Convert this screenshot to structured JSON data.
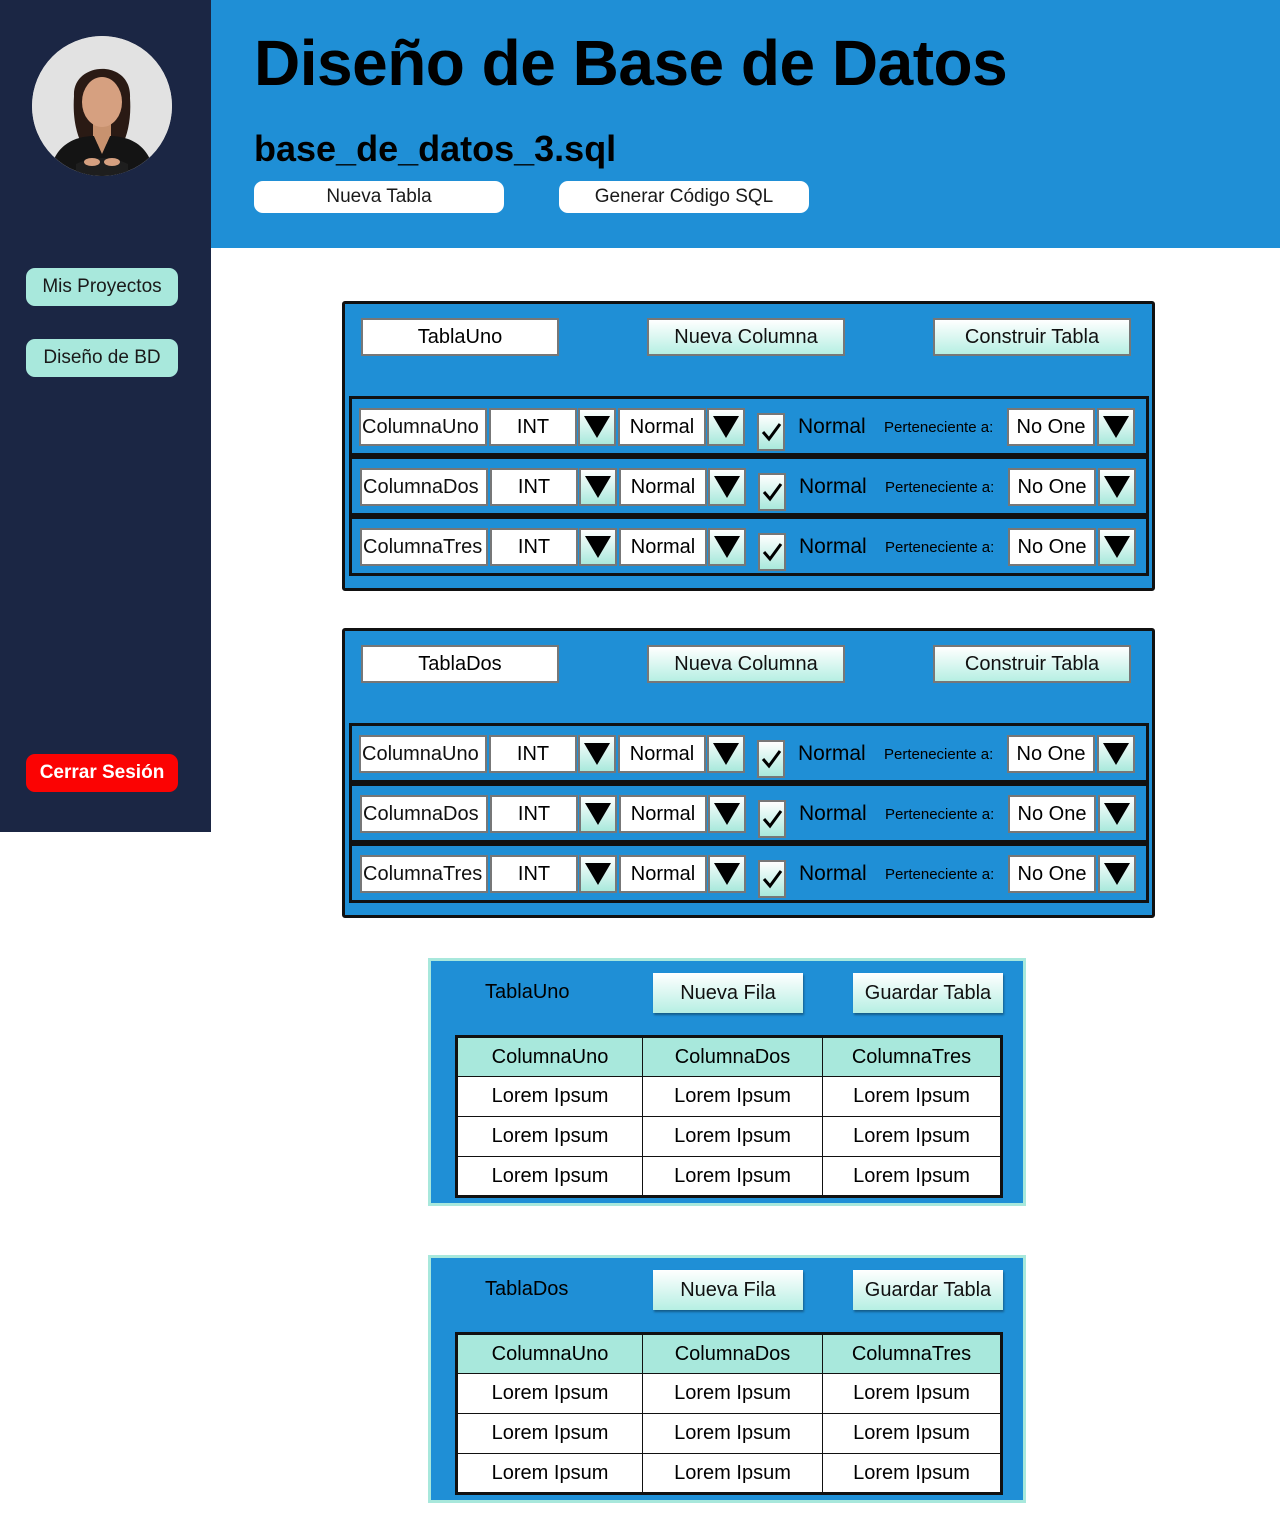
{
  "sidebar": {
    "nav": [
      "Mis Proyectos",
      "Diseño de BD"
    ],
    "logout_label": "Cerrar Sesión"
  },
  "header": {
    "title": "Diseño de Base de Datos",
    "file_name": "base_de_datos_3.sql",
    "new_table_label": "Nueva Tabla",
    "generate_sql_label": "Generar Código SQL"
  },
  "colors": {
    "primary": "#1f8fd6",
    "sidebar": "#1b2644",
    "accent": "#a8e8dc",
    "danger": "#fb0303"
  },
  "icons": {
    "dropdown": "triangle-down-icon",
    "check": "check-icon"
  },
  "design_tables": [
    {
      "name": "TablaUno",
      "new_column_label": "Nueva Columna",
      "build_label": "Construir Tabla",
      "columns": [
        {
          "name": "ColumnaUno",
          "type": "INT",
          "modifier": "Normal",
          "checked": true,
          "check_label": "Normal",
          "belongs_label": "Perteneciente a:",
          "belongs_to": "No One"
        },
        {
          "name": "ColumnaDos",
          "type": "INT",
          "modifier": "Normal",
          "checked": true,
          "check_label": "Normal",
          "belongs_label": "Perteneciente a:",
          "belongs_to": "No One"
        },
        {
          "name": "ColumnaTres",
          "type": "INT",
          "modifier": "Normal",
          "checked": true,
          "check_label": "Normal",
          "belongs_label": "Perteneciente a:",
          "belongs_to": "No One"
        }
      ]
    },
    {
      "name": "TablaDos",
      "new_column_label": "Nueva Columna",
      "build_label": "Construir Tabla",
      "columns": [
        {
          "name": "ColumnaUno",
          "type": "INT",
          "modifier": "Normal",
          "checked": true,
          "check_label": "Normal",
          "belongs_label": "Perteneciente a:",
          "belongs_to": "No One"
        },
        {
          "name": "ColumnaDos",
          "type": "INT",
          "modifier": "Normal",
          "checked": true,
          "check_label": "Normal",
          "belongs_label": "Perteneciente a:",
          "belongs_to": "No One"
        },
        {
          "name": "ColumnaTres",
          "type": "INT",
          "modifier": "Normal",
          "checked": true,
          "check_label": "Normal",
          "belongs_label": "Perteneciente a:",
          "belongs_to": "No One"
        }
      ]
    }
  ],
  "data_tables": [
    {
      "name": "TablaUno",
      "new_row_label": "Nueva Fila",
      "save_label": "Guardar Tabla",
      "headers": [
        "ColumnaUno",
        "ColumnaDos",
        "ColumnaTres"
      ],
      "rows": [
        [
          "Lorem Ipsum",
          "Lorem Ipsum",
          "Lorem Ipsum"
        ],
        [
          "Lorem Ipsum",
          "Lorem Ipsum",
          "Lorem Ipsum"
        ],
        [
          "Lorem Ipsum",
          "Lorem Ipsum",
          "Lorem Ipsum"
        ]
      ]
    },
    {
      "name": "TablaDos",
      "new_row_label": "Nueva Fila",
      "save_label": "Guardar Tabla",
      "headers": [
        "ColumnaUno",
        "ColumnaDos",
        "ColumnaTres"
      ],
      "rows": [
        [
          "Lorem Ipsum",
          "Lorem Ipsum",
          "Lorem Ipsum"
        ],
        [
          "Lorem Ipsum",
          "Lorem Ipsum",
          "Lorem Ipsum"
        ],
        [
          "Lorem Ipsum",
          "Lorem Ipsum",
          "Lorem Ipsum"
        ]
      ]
    }
  ]
}
